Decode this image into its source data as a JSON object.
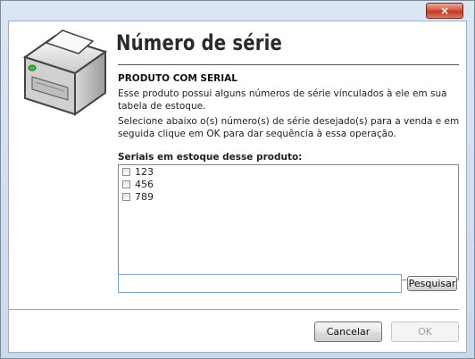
{
  "window": {
    "close_glyph": "×"
  },
  "header": {
    "title": "Número de série",
    "icon": "printer-icon"
  },
  "section": {
    "heading": "PRODUTO COM SERIAL",
    "paragraph1": "Esse produto possui alguns números de série vínculados à ele em sua tabela de estoque.",
    "paragraph2": "Selecione abaixo o(s) número(s) de série desejado(s) para a venda e em seguida clique em OK para dar sequência à essa operação."
  },
  "serials": {
    "label": "Seriais em estoque desse produto:",
    "items": [
      {
        "label": "123",
        "checked": false
      },
      {
        "label": "456",
        "checked": false
      },
      {
        "label": "789",
        "checked": false
      }
    ]
  },
  "search": {
    "value": "",
    "placeholder": "",
    "button_label": "Pesquisar"
  },
  "footer": {
    "cancel_label": "Cancelar",
    "ok_label": "OK"
  }
}
